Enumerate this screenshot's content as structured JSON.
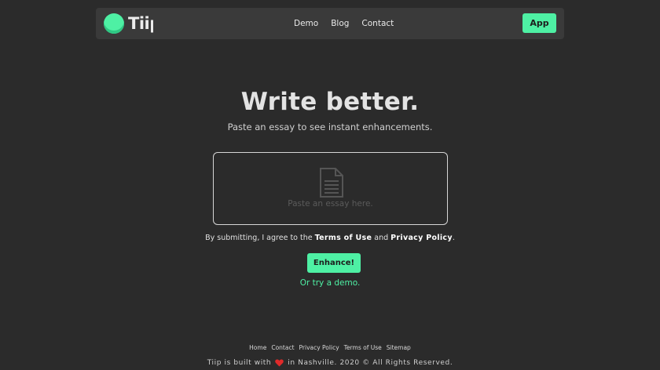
{
  "brand": {
    "name": "Tiip",
    "accent_color": "#4ef0a4",
    "logo_icon": "logo-circle-icon"
  },
  "nav": {
    "links": [
      "Demo",
      "Blog",
      "Contact"
    ],
    "app_button": "App"
  },
  "hero": {
    "title": "Write better.",
    "subtitle": "Paste an essay to see instant enhancements."
  },
  "essay": {
    "placeholder": "Paste an essay here.",
    "icon": "document-icon"
  },
  "agreement": {
    "prefix": "By submitting, I agree to the",
    "terms": "Terms of Use",
    "conjunction": "and",
    "privacy": "Privacy Policy",
    "suffix": "."
  },
  "actions": {
    "enhance": "Enhance!",
    "demo": "Or try a demo."
  },
  "footer": {
    "links": [
      "Home",
      "Contact",
      "Privacy Policy",
      "Terms of Use",
      "Sitemap"
    ],
    "copyright_prefix": "Tiip is built with",
    "heart_icon": "heart-icon",
    "copyright_suffix": "in Nashville. 2020 © All Rights Reserved."
  }
}
